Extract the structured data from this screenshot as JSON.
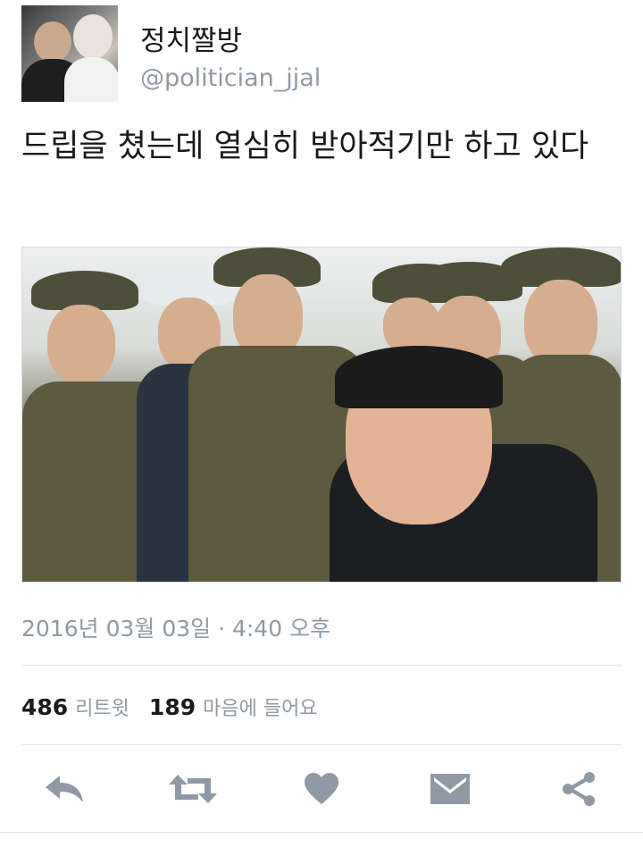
{
  "tweet": {
    "author": {
      "display_name": "정치짤방",
      "handle": "@politician_jjal"
    },
    "text": "드립을 쳤는데 열심히 받아적기만 하고 있다",
    "timestamp": "2016년 03월 03일 · 4:40 오후",
    "stats": {
      "retweets": "486",
      "retweets_label": "리트윗",
      "likes": "189",
      "likes_label": "마음에 들어요"
    }
  },
  "actions": [
    "reply-icon",
    "retweet-icon",
    "heart-icon",
    "dm-icon",
    "share-icon"
  ],
  "colors": {
    "secondary_text": "#8f9aa4",
    "divider": "#e1e6ea"
  }
}
